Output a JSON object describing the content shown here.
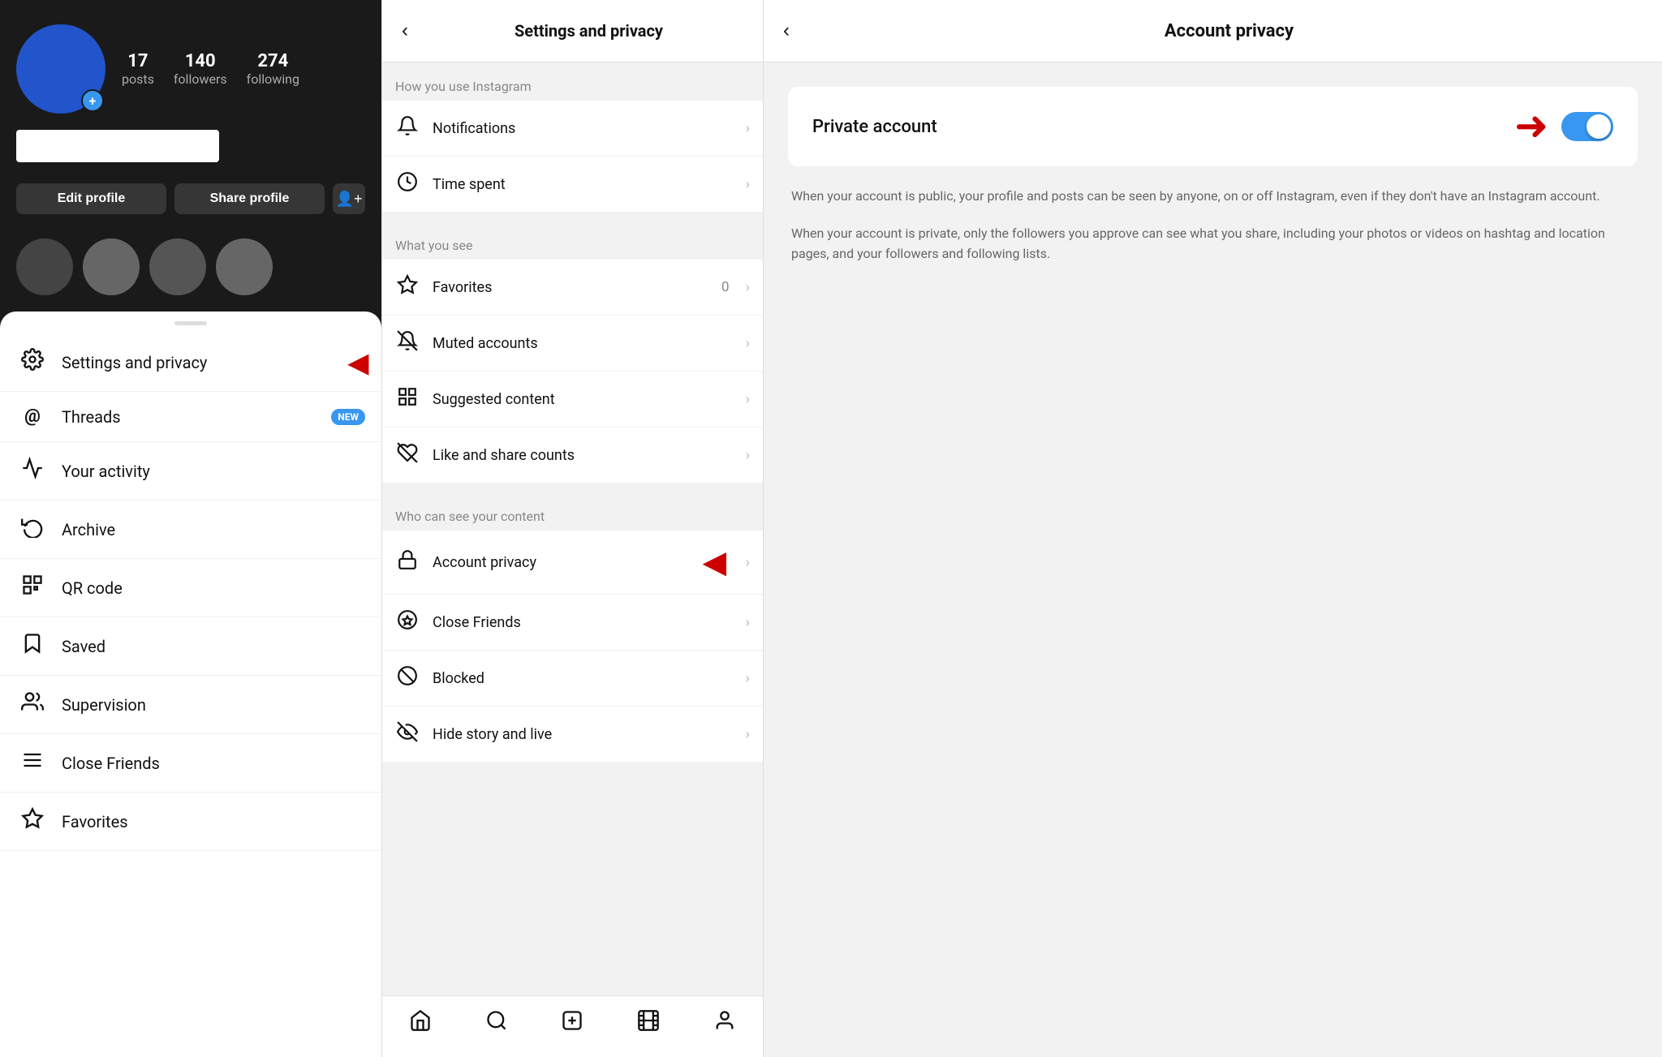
{
  "profile": {
    "posts_count": "17",
    "posts_label": "posts",
    "followers_count": "140",
    "followers_label": "followers",
    "following_count": "274",
    "following_label": "following",
    "edit_profile_label": "Edit profile",
    "share_profile_label": "Share profile",
    "add_icon": "+"
  },
  "menu": {
    "items": [
      {
        "label": "Settings and privacy",
        "icon": "⚙",
        "badge": null,
        "arrow": true
      },
      {
        "label": "Threads",
        "icon": "Ⓣ",
        "badge": "NEW",
        "arrow": false
      },
      {
        "label": "Your activity",
        "icon": "📊",
        "badge": null,
        "arrow": false
      },
      {
        "label": "Archive",
        "icon": "🕐",
        "badge": null,
        "arrow": false
      },
      {
        "label": "QR code",
        "icon": "⊞",
        "badge": null,
        "arrow": false
      },
      {
        "label": "Saved",
        "icon": "🔖",
        "badge": null,
        "arrow": false
      },
      {
        "label": "Supervision",
        "icon": "👥",
        "badge": null,
        "arrow": false
      },
      {
        "label": "Close Friends",
        "icon": "☰",
        "badge": null,
        "arrow": false
      },
      {
        "label": "Favorites",
        "icon": "☆",
        "badge": null,
        "arrow": false
      }
    ]
  },
  "settings": {
    "title": "Settings and privacy",
    "section1_label": "How you use Instagram",
    "section2_label": "What you see",
    "section3_label": "Who can see your content",
    "items_section1": [
      {
        "label": "Notifications",
        "icon": "bell",
        "count": null
      },
      {
        "label": "Time spent",
        "icon": "clock",
        "count": null
      }
    ],
    "items_section2": [
      {
        "label": "Favorites",
        "icon": "star",
        "count": "0"
      },
      {
        "label": "Muted accounts",
        "icon": "mute",
        "count": null
      },
      {
        "label": "Suggested content",
        "icon": "grid",
        "count": null
      },
      {
        "label": "Like and share counts",
        "icon": "heart-off",
        "count": null
      }
    ],
    "items_section3": [
      {
        "label": "Account privacy",
        "icon": "lock",
        "count": null
      },
      {
        "label": "Close Friends",
        "icon": "circle-star",
        "count": null
      },
      {
        "label": "Blocked",
        "icon": "block",
        "count": null
      },
      {
        "label": "Hide story and live",
        "icon": "eye-off",
        "count": null
      }
    ]
  },
  "bottom_nav": {
    "icons": [
      "home",
      "search",
      "add",
      "reels",
      "profile"
    ]
  },
  "account_privacy": {
    "title": "Account privacy",
    "private_account_label": "Private account",
    "toggle_on": true,
    "desc1": "When your account is public, your profile and posts can be seen by anyone, on or off Instagram, even if they don't have an Instagram account.",
    "desc2": "When your account is private, only the followers you approve can see what you share, including your photos or videos on hashtag and location pages, and your followers and following lists."
  }
}
